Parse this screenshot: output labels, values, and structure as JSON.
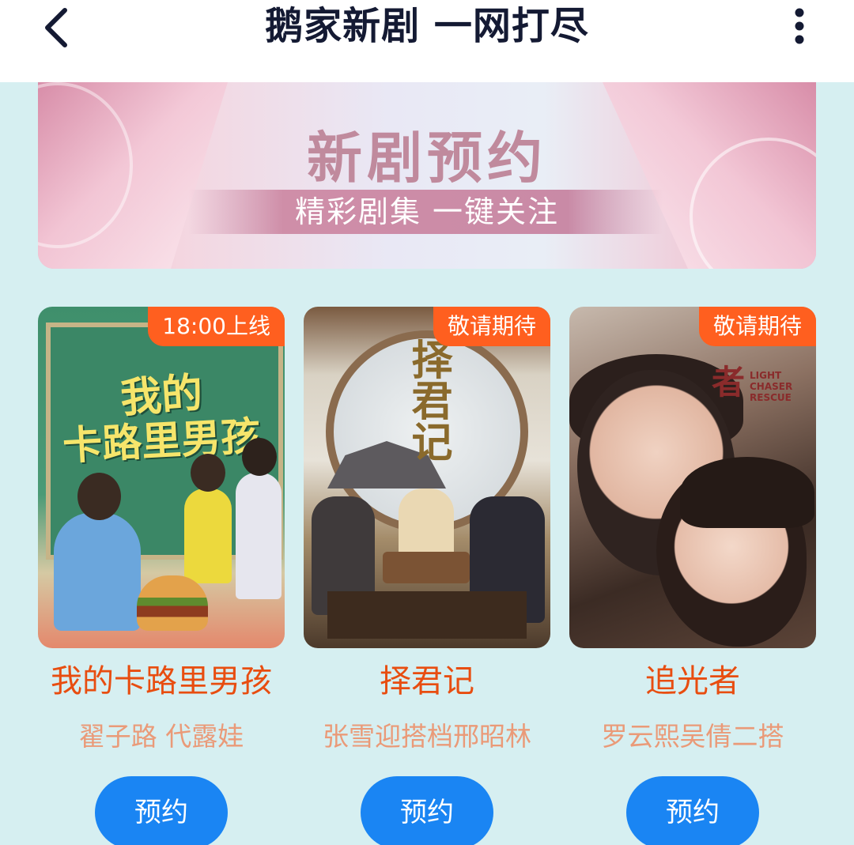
{
  "header": {
    "title": "鹅家新剧 一网打尽",
    "back_icon": "chevron-left-icon",
    "more_icon": "more-vertical-icon"
  },
  "banner": {
    "title": "新剧预约",
    "subtitle": "精彩剧集 一键关注"
  },
  "shows": [
    {
      "tag": "18:00上线",
      "poster_title_line1": "我的",
      "poster_title_line2": "卡路里男孩",
      "title": "我的卡路里男孩",
      "subtitle": "翟子路 代露娃",
      "button": "预约"
    },
    {
      "tag": "敬请期待",
      "poster_title_line1": "择君记",
      "title": "择君记",
      "subtitle": "张雪迎搭档邢昭林",
      "button": "预约"
    },
    {
      "tag": "敬请期待",
      "poster_title_line1": "者",
      "poster_title_en": "LIGHT CHASER RESCUE",
      "title": "追光者",
      "subtitle": "罗云熙吴倩二搭",
      "button": "预约"
    }
  ],
  "colors": {
    "background": "#d6eff1",
    "tag": "#ff5f1f",
    "title": "#e84d10",
    "subtitle": "#ea9a78",
    "button": "#1a85f3"
  }
}
